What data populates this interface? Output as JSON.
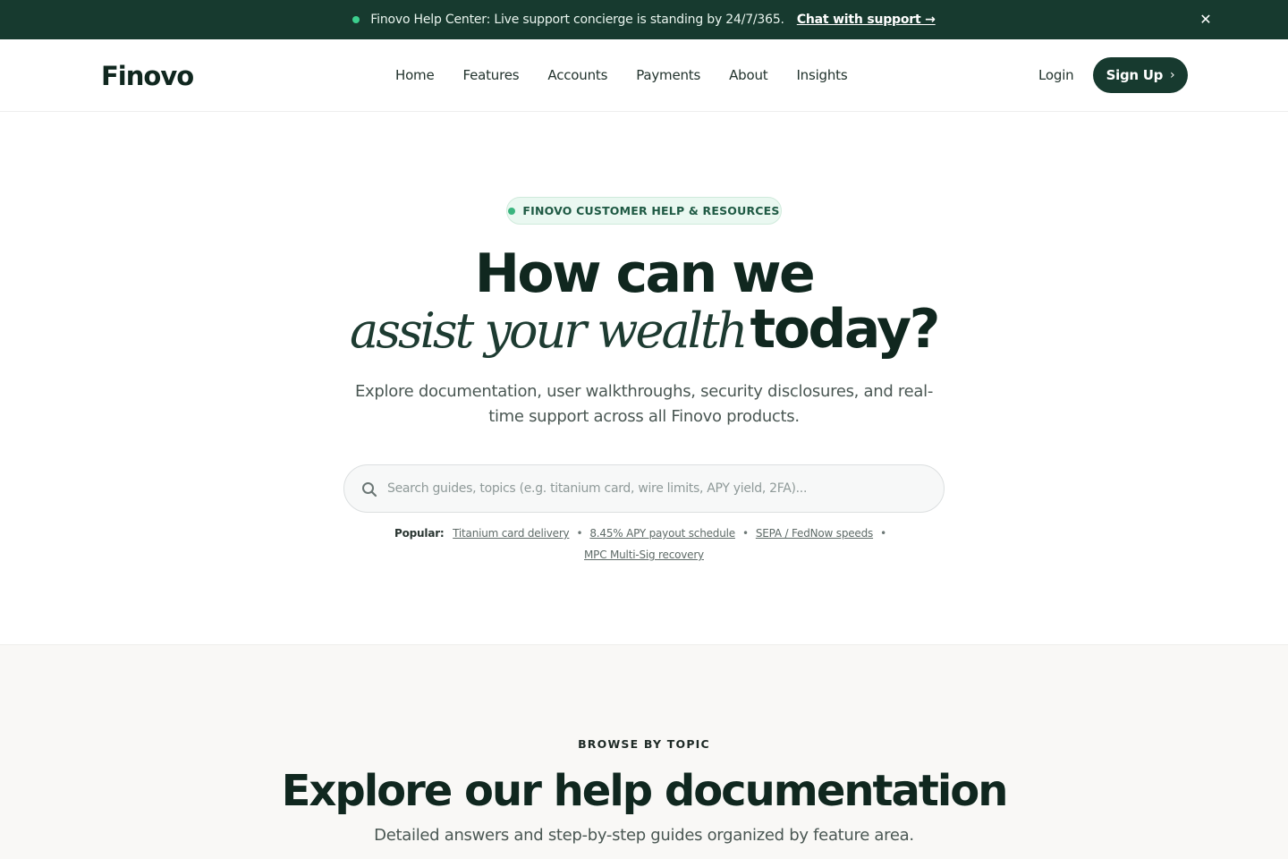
{
  "announcement": {
    "message": "Finovo Help Center: Live support concierge is standing by 24/7/365.",
    "link_label": "Chat with support →",
    "close_label": "✕"
  },
  "nav": {
    "logo": "Finovo",
    "links": [
      "Home",
      "Features",
      "Accounts",
      "Payments",
      "About",
      "Insights"
    ],
    "login_label": "Login",
    "signup_label": "Sign Up",
    "signup_chevron": "›"
  },
  "hero": {
    "badge": "FINOVO CUSTOMER HELP & RESOURCES",
    "title_line1": "How can we",
    "title_italic": "assist your wealth",
    "title_bold": "today?",
    "subtitle": "Explore documentation, user walkthroughs, security disclosures, and real-time support across all Finovo products.",
    "search_placeholder": "Search guides, topics (e.g. titanium card, wire limits, APY yield, 2FA)...",
    "popular_label": "Popular:",
    "popular_links": [
      "Titanium card delivery",
      "8.45% APY payout schedule",
      "SEPA / FedNow speeds",
      "MPC Multi-Sig recovery"
    ]
  },
  "browse": {
    "eyebrow": "BROWSE BY TOPIC",
    "title": "Explore our help documentation",
    "subtitle": "Detailed answers and step-by-step guides organized by feature area."
  },
  "colors": {
    "brand_dark": "#173a2f",
    "accent_green": "#3ccf8e",
    "badge_bg": "#eaf8f1"
  }
}
